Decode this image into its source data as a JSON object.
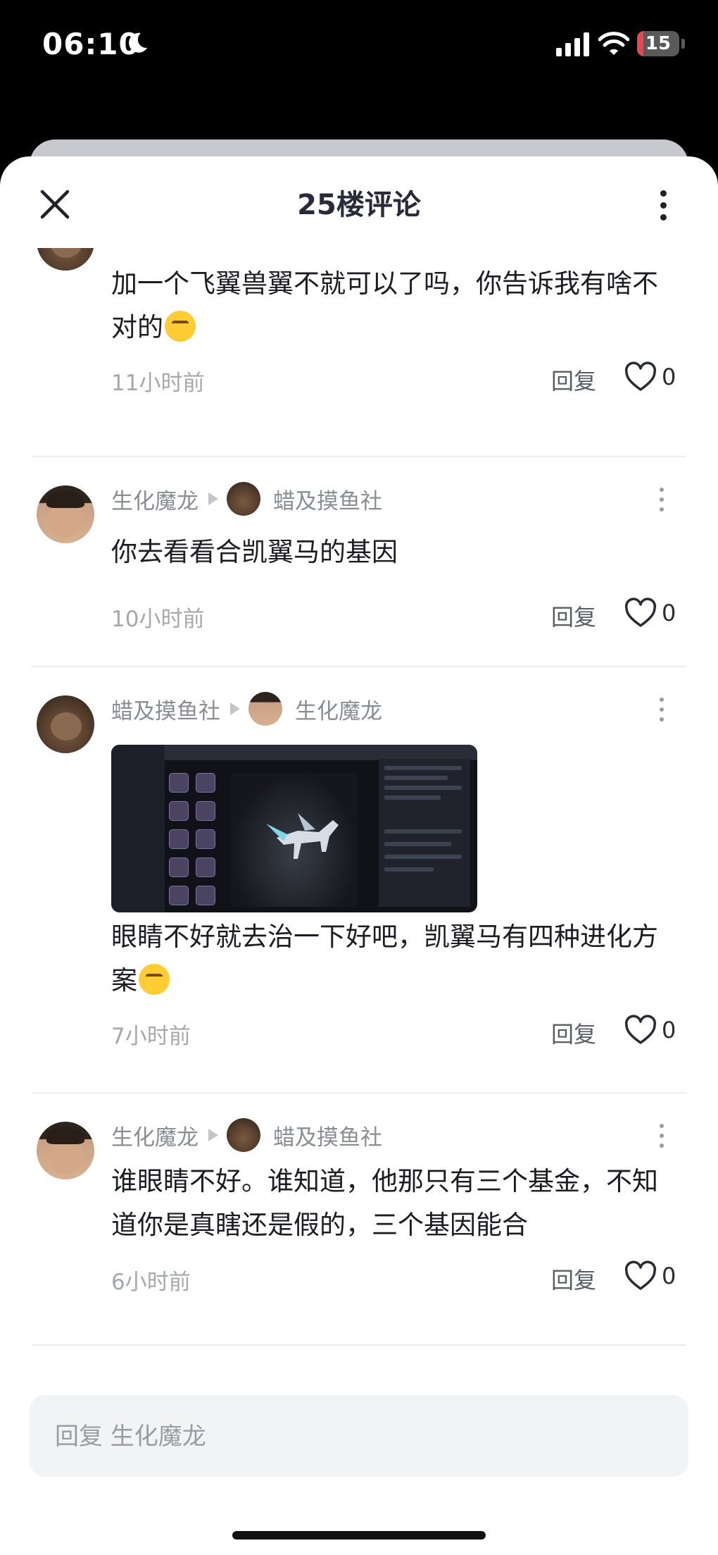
{
  "status_bar": {
    "time": "06:10",
    "battery": "15",
    "battery_fraction": 0.15
  },
  "header": {
    "title": "25楼评论"
  },
  "comments": [
    {
      "text": "加一个飞翼兽翼不就可以了吗，你告诉我有啥不对的",
      "time": "11小时前",
      "reply": "回复",
      "likes": "0"
    },
    {
      "author": "生化魔龙",
      "reply_to": "蜡及摸鱼社",
      "text": "你去看看合凯翼马的基因",
      "time": "10小时前",
      "reply": "回复",
      "likes": "0"
    },
    {
      "author": "蜡及摸鱼社",
      "reply_to": "生化魔龙",
      "text": "眼睛不好就去治一下好吧，凯翼马有四种进化方案",
      "time": "7小时前",
      "reply": "回复",
      "likes": "0"
    },
    {
      "author": "生化魔龙",
      "reply_to": "蜡及摸鱼社",
      "text": "谁眼睛不好。谁知道，他那只有三个基金，不知道你是真瞎还是假的，三个基因能合",
      "time": "6小时前",
      "reply": "回复",
      "likes": "0"
    }
  ],
  "input": {
    "placeholder": "回复 生化魔龙"
  },
  "colors": {
    "accent_battery": "#e5484d",
    "text_primary": "#1c1d24",
    "text_muted": "#a6a8ae"
  },
  "icons": [
    "moon-icon",
    "signal-icon",
    "wifi-icon",
    "close-icon",
    "more-icon",
    "heart-icon",
    "reply-arrow-icon"
  ]
}
